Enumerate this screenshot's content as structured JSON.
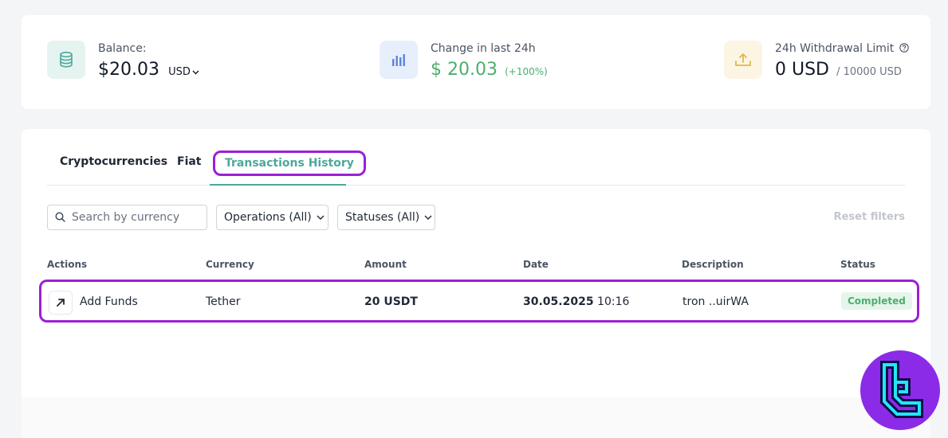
{
  "stats": {
    "balance": {
      "label": "Balance:",
      "value": "$20.03",
      "currency": "USD",
      "icon": "database-icon"
    },
    "change": {
      "label": "Change in last 24h",
      "value": "$ 20.03",
      "percent": "(+100%)",
      "icon": "bar-chart-icon"
    },
    "limit": {
      "label": "24h Withdrawal Limit",
      "value": "0 USD",
      "max": "/ 10000 USD",
      "icon": "upload-icon"
    }
  },
  "tabs": [
    {
      "label": "Cryptocurrencies"
    },
    {
      "label": "Fiat"
    },
    {
      "label": "Transactions History",
      "active": true
    }
  ],
  "filters": {
    "search_placeholder": "Search by currency",
    "operations": "Operations (All)",
    "statuses": "Statuses (All)",
    "reset": "Reset filters"
  },
  "table": {
    "columns": [
      "Actions",
      "Currency",
      "Amount",
      "Date",
      "Description",
      "Status"
    ],
    "rows": [
      {
        "action": "Add Funds",
        "currency": "Tether",
        "amount": "20 USDT",
        "date": "30.05.2025",
        "time": "10:16",
        "description": "tron ..uirWA",
        "status": "Completed"
      }
    ]
  },
  "colors": {
    "accent": "#4da89c",
    "highlight": "#9b1fd6",
    "positive": "#4cae6e",
    "muted": "#c2c6cc"
  }
}
